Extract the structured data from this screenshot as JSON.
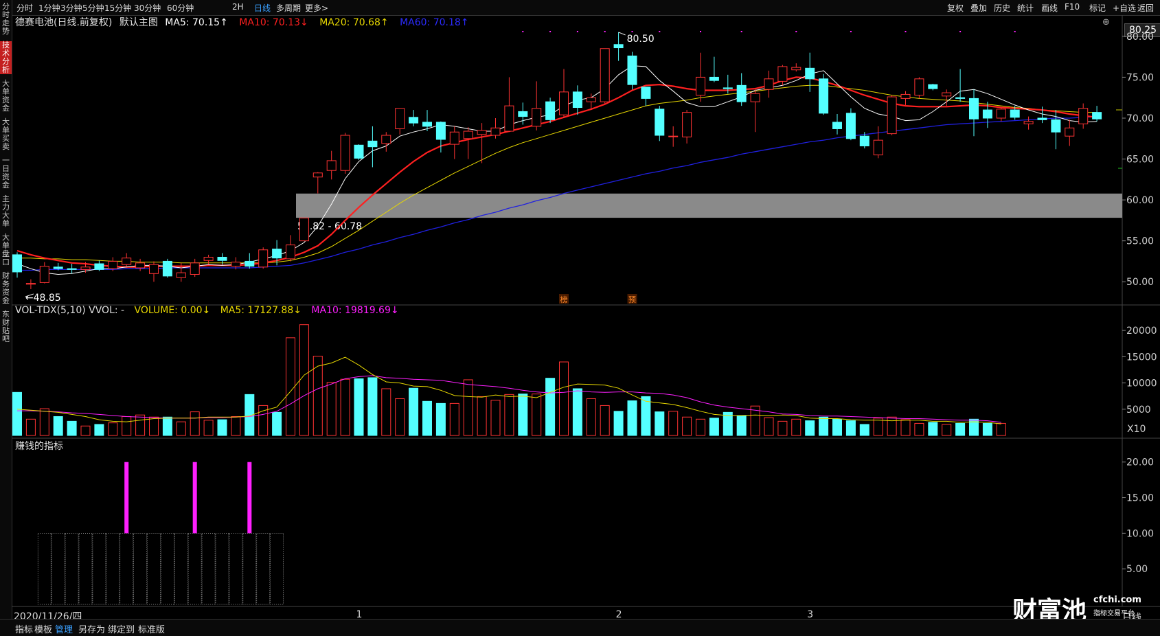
{
  "topbar": {
    "timeframes": [
      "分时",
      "1分钟",
      "3分钟",
      "5分钟",
      "15分钟",
      "30分钟",
      "60分钟",
      "2H",
      "日线",
      "多周期",
      "更多>"
    ],
    "active_timeframe": "日线",
    "tools": [
      "复权",
      "叠加",
      "历史",
      "统计",
      "画线",
      "F10",
      "标记",
      "+自选",
      "返回"
    ]
  },
  "sidebar": {
    "items": [
      "分时走势",
      "技术分析",
      "大单资金",
      "大单买卖",
      "一日资金",
      "主力大单",
      "大单盘口",
      "财务资金",
      "东财贴吧"
    ],
    "active": "技术分析"
  },
  "main_legend": {
    "stock": "德赛电池(日线.前复权)",
    "indicator": "默认主图",
    "ma5": "MA5: 70.15↑",
    "ma10": "MA10: 70.13↓",
    "ma20": "MA20: 70.68↑",
    "ma60": "MA60: 70.18↑"
  },
  "colors": {
    "up": "#ff3333",
    "down": "#54ffff",
    "ma5": "#ffffff",
    "ma10": "#ff2020",
    "ma20": "#e8d800",
    "ma60": "#2020e0",
    "magenta": "#ff20ff",
    "band": "#8a8a8a"
  },
  "annotations": {
    "high_label": "80.50",
    "low_label": "48.85",
    "band_label": "57.82 - 60.78",
    "marker1": "榜",
    "marker2": "预",
    "current_price": "80.25"
  },
  "vol_legend": {
    "name": "VOL-TDX(5,10) VVOL: -",
    "volume": "VOLUME: 0.00↓",
    "ma5": "MA5: 17127.88↓",
    "ma10": "MA10: 19819.69↓"
  },
  "vol_unit": "X10",
  "ind_legend": "赚钱的指标",
  "bottom": {
    "date": "2020/11/26/四",
    "tabs": [
      "指标",
      "模板",
      "管理",
      "另存为",
      "绑定到",
      "标准版"
    ],
    "active_tab": "管理",
    "period": "日线"
  },
  "logo": {
    "main": "财富池",
    "site": "cfchi.com",
    "tagline": "指标交易平台"
  },
  "chart_data": [
    {
      "type": "candlestick",
      "title": "德赛电池(日线.前复权)",
      "y_ticks": [
        "80.00",
        "75.00",
        "70.00",
        "65.00",
        "60.00",
        "55.00",
        "50.00"
      ],
      "ylim": [
        47.5,
        81.5
      ],
      "x_ticks": [
        "1",
        "2",
        "3"
      ],
      "candles": [
        {
          "o": 53.3,
          "h": 53.6,
          "l": 50.5,
          "c": 51.2
        },
        {
          "o": 49.7,
          "h": 50.3,
          "l": 49.1,
          "c": 49.8
        },
        {
          "o": 49.9,
          "h": 52.4,
          "l": 49.8,
          "c": 51.9
        },
        {
          "o": 51.8,
          "h": 52.3,
          "l": 51.4,
          "c": 51.6
        },
        {
          "o": 51.6,
          "h": 52.2,
          "l": 51.0,
          "c": 51.5
        },
        {
          "o": 51.5,
          "h": 52.4,
          "l": 51.1,
          "c": 51.8
        },
        {
          "o": 52.2,
          "h": 52.6,
          "l": 51.3,
          "c": 51.5
        },
        {
          "o": 51.6,
          "h": 53.0,
          "l": 51.3,
          "c": 52.5
        },
        {
          "o": 52.1,
          "h": 53.5,
          "l": 51.9,
          "c": 52.9
        },
        {
          "o": 51.7,
          "h": 52.8,
          "l": 51.3,
          "c": 52.3
        },
        {
          "o": 51.0,
          "h": 52.5,
          "l": 50.0,
          "c": 52.1
        },
        {
          "o": 52.5,
          "h": 52.8,
          "l": 50.5,
          "c": 50.7
        },
        {
          "o": 50.5,
          "h": 52.3,
          "l": 50.0,
          "c": 51.1
        },
        {
          "o": 50.9,
          "h": 52.8,
          "l": 50.6,
          "c": 52.3
        },
        {
          "o": 52.6,
          "h": 53.3,
          "l": 52.1,
          "c": 53.0
        },
        {
          "o": 53.0,
          "h": 53.5,
          "l": 52.1,
          "c": 52.6
        },
        {
          "o": 51.9,
          "h": 53.0,
          "l": 51.5,
          "c": 52.4
        },
        {
          "o": 52.5,
          "h": 53.5,
          "l": 51.6,
          "c": 51.9
        },
        {
          "o": 51.8,
          "h": 54.2,
          "l": 51.6,
          "c": 53.9
        },
        {
          "o": 54.0,
          "h": 55.1,
          "l": 52.0,
          "c": 52.9
        },
        {
          "o": 52.8,
          "h": 55.7,
          "l": 52.5,
          "c": 54.5
        },
        {
          "o": 55.0,
          "h": 57.8,
          "l": 55.0,
          "c": 57.8
        },
        {
          "o": 62.8,
          "h": 63.4,
          "l": 60.8,
          "c": 63.3
        },
        {
          "o": 63.6,
          "h": 66.0,
          "l": 62.5,
          "c": 64.8
        },
        {
          "o": 63.6,
          "h": 68.2,
          "l": 63.2,
          "c": 67.9
        },
        {
          "o": 66.7,
          "h": 66.8,
          "l": 64.9,
          "c": 65.1
        },
        {
          "o": 67.2,
          "h": 69.0,
          "l": 64.0,
          "c": 66.5
        },
        {
          "o": 66.9,
          "h": 68.3,
          "l": 65.9,
          "c": 67.9
        },
        {
          "o": 68.7,
          "h": 71.2,
          "l": 68.0,
          "c": 71.2
        },
        {
          "o": 70.1,
          "h": 71.0,
          "l": 69.0,
          "c": 69.4
        },
        {
          "o": 69.5,
          "h": 71.0,
          "l": 68.4,
          "c": 69.0
        },
        {
          "o": 69.5,
          "h": 69.6,
          "l": 65.8,
          "c": 67.4
        },
        {
          "o": 66.8,
          "h": 69.0,
          "l": 65.0,
          "c": 68.3
        },
        {
          "o": 67.5,
          "h": 68.9,
          "l": 65.0,
          "c": 68.4
        },
        {
          "o": 68.0,
          "h": 69.4,
          "l": 64.5,
          "c": 68.5
        },
        {
          "o": 67.9,
          "h": 70.0,
          "l": 67.5,
          "c": 68.8
        },
        {
          "o": 68.4,
          "h": 75.0,
          "l": 68.3,
          "c": 71.5
        },
        {
          "o": 70.8,
          "h": 71.9,
          "l": 69.2,
          "c": 70.2
        },
        {
          "o": 69.0,
          "h": 74.5,
          "l": 68.5,
          "c": 71.2
        },
        {
          "o": 72.0,
          "h": 72.5,
          "l": 69.4,
          "c": 69.8
        },
        {
          "o": 70.4,
          "h": 76.0,
          "l": 70.0,
          "c": 73.2
        },
        {
          "o": 73.2,
          "h": 74.0,
          "l": 70.4,
          "c": 71.3
        },
        {
          "o": 72.0,
          "h": 73.0,
          "l": 71.0,
          "c": 72.5
        },
        {
          "o": 72.0,
          "h": 78.5,
          "l": 71.8,
          "c": 78.5
        },
        {
          "o": 79.0,
          "h": 80.5,
          "l": 77.0,
          "c": 78.6
        },
        {
          "o": 77.6,
          "h": 78.1,
          "l": 73.5,
          "c": 74.1
        },
        {
          "o": 73.8,
          "h": 73.8,
          "l": 71.5,
          "c": 72.4
        },
        {
          "o": 71.1,
          "h": 71.5,
          "l": 67.2,
          "c": 67.9
        },
        {
          "o": 67.8,
          "h": 69.0,
          "l": 66.5,
          "c": 67.8
        },
        {
          "o": 67.7,
          "h": 71.0,
          "l": 66.9,
          "c": 70.7
        },
        {
          "o": 72.8,
          "h": 78.0,
          "l": 72.0,
          "c": 75.0
        },
        {
          "o": 75.0,
          "h": 77.5,
          "l": 74.4,
          "c": 74.6
        },
        {
          "o": 73.7,
          "h": 75.3,
          "l": 73.0,
          "c": 73.6
        },
        {
          "o": 74.0,
          "h": 75.5,
          "l": 71.5,
          "c": 72.0
        },
        {
          "o": 72.0,
          "h": 73.5,
          "l": 68.3,
          "c": 73.0
        },
        {
          "o": 73.5,
          "h": 75.8,
          "l": 72.5,
          "c": 74.8
        },
        {
          "o": 74.5,
          "h": 76.5,
          "l": 74.0,
          "c": 76.3
        },
        {
          "o": 75.9,
          "h": 76.7,
          "l": 75.7,
          "c": 76.2
        },
        {
          "o": 76.1,
          "h": 78.0,
          "l": 73.2,
          "c": 74.8
        },
        {
          "o": 74.8,
          "h": 75.4,
          "l": 70.4,
          "c": 70.6
        },
        {
          "o": 69.5,
          "h": 70.5,
          "l": 68.0,
          "c": 68.7
        },
        {
          "o": 70.6,
          "h": 71.2,
          "l": 67.3,
          "c": 67.5
        },
        {
          "o": 67.8,
          "h": 68.3,
          "l": 66.3,
          "c": 66.6
        },
        {
          "o": 65.5,
          "h": 69.0,
          "l": 65.1,
          "c": 67.3
        },
        {
          "o": 68.1,
          "h": 72.8,
          "l": 67.9,
          "c": 72.6
        },
        {
          "o": 72.4,
          "h": 73.3,
          "l": 71.6,
          "c": 72.9
        },
        {
          "o": 72.8,
          "h": 75.0,
          "l": 72.4,
          "c": 74.8
        },
        {
          "o": 74.1,
          "h": 74.2,
          "l": 73.4,
          "c": 73.6
        },
        {
          "o": 72.7,
          "h": 73.5,
          "l": 71.5,
          "c": 73.1
        },
        {
          "o": 72.5,
          "h": 76.0,
          "l": 72.0,
          "c": 72.4
        },
        {
          "o": 72.4,
          "h": 73.5,
          "l": 67.8,
          "c": 69.9
        },
        {
          "o": 71.0,
          "h": 72.0,
          "l": 68.8,
          "c": 70.0
        },
        {
          "o": 70.0,
          "h": 71.3,
          "l": 69.6,
          "c": 71.1
        },
        {
          "o": 71.0,
          "h": 71.5,
          "l": 69.8,
          "c": 70.1
        },
        {
          "o": 69.3,
          "h": 70.2,
          "l": 68.6,
          "c": 69.6
        },
        {
          "o": 70.0,
          "h": 71.4,
          "l": 69.4,
          "c": 69.8
        },
        {
          "o": 69.8,
          "h": 71.0,
          "l": 66.2,
          "c": 68.3
        },
        {
          "o": 67.8,
          "h": 69.8,
          "l": 66.6,
          "c": 68.8
        },
        {
          "o": 69.3,
          "h": 71.8,
          "l": 68.7,
          "c": 71.2
        },
        {
          "o": 70.7,
          "h": 71.5,
          "l": 69.6,
          "c": 69.9
        }
      ],
      "ma_lines": {
        "ma5": [
          52.2,
          51.6,
          51.1,
          50.9,
          51.0,
          51.3,
          51.6,
          51.6,
          51.8,
          52.0,
          52.0,
          51.9,
          51.7,
          51.9,
          52.1,
          52.0,
          52.1,
          52.4,
          52.8,
          53.2,
          53.8,
          54.8,
          56.8,
          59.5,
          62.6,
          64.7,
          66.0,
          66.6,
          67.8,
          68.3,
          68.7,
          69.2,
          69.0,
          68.7,
          68.4,
          68.4,
          69.2,
          69.7,
          70.1,
          70.4,
          71.5,
          72.2,
          72.5,
          73.6,
          75.3,
          76.4,
          76.3,
          74.6,
          73.3,
          71.9,
          71.4,
          71.4,
          72.0,
          72.6,
          73.4,
          73.7,
          74.0,
          74.6,
          75.4,
          75.8,
          74.2,
          72.6,
          71.2,
          70.5,
          70.2,
          69.7,
          69.8,
          70.8,
          72.0,
          73.3,
          73.5,
          73.0,
          72.3,
          71.6,
          71.0,
          70.5,
          70.2,
          69.7,
          69.5,
          69.6
        ],
        "ma10": [
          53.8,
          53.3,
          52.9,
          52.6,
          52.3,
          52.2,
          52.0,
          51.9,
          51.8,
          51.8,
          51.9,
          51.9,
          51.9,
          51.9,
          52.0,
          52.0,
          52.0,
          52.1,
          52.3,
          52.6,
          53.0,
          53.6,
          54.4,
          55.8,
          57.5,
          59.1,
          60.6,
          62.0,
          63.4,
          64.7,
          65.8,
          66.6,
          67.0,
          67.4,
          67.7,
          68.0,
          68.4,
          68.8,
          69.2,
          69.6,
          70.1,
          70.6,
          71.1,
          71.7,
          72.5,
          73.4,
          74.0,
          74.1,
          73.9,
          73.6,
          73.4,
          73.4,
          73.4,
          73.5,
          73.6,
          74.0,
          74.6,
          75.0,
          74.9,
          74.5,
          74.0,
          73.4,
          72.8,
          72.3,
          71.8,
          71.5,
          71.4,
          71.4,
          71.4,
          71.5,
          71.6,
          71.5,
          71.3,
          71.2,
          71.1,
          71.0,
          70.8,
          70.5,
          70.3,
          70.1
        ],
        "ma20": [
          52.9,
          52.9,
          52.8,
          52.8,
          52.7,
          52.7,
          52.6,
          52.5,
          52.5,
          52.4,
          52.4,
          52.4,
          52.3,
          52.3,
          52.3,
          52.3,
          52.3,
          52.3,
          52.3,
          52.4,
          52.6,
          53.0,
          53.5,
          54.3,
          55.3,
          56.3,
          57.4,
          58.5,
          59.6,
          60.6,
          61.5,
          62.4,
          63.3,
          64.1,
          64.9,
          65.7,
          66.4,
          67.0,
          67.5,
          68.0,
          68.5,
          69.0,
          69.5,
          70.0,
          70.5,
          71.0,
          71.5,
          71.8,
          72.0,
          72.2,
          72.5,
          72.7,
          72.9,
          73.1,
          73.3,
          73.5,
          73.7,
          73.9,
          74.0,
          74.0,
          73.8,
          73.6,
          73.4,
          73.1,
          72.8,
          72.6,
          72.4,
          72.3,
          72.2,
          72.1,
          71.9,
          71.7,
          71.5,
          71.3,
          71.2,
          71.0,
          70.9,
          70.8,
          70.7,
          70.7
        ],
        "ma60": [
          51.4,
          51.4,
          51.5,
          51.5,
          51.5,
          51.5,
          51.5,
          51.5,
          51.6,
          51.6,
          51.6,
          51.7,
          51.7,
          51.7,
          51.7,
          51.7,
          51.7,
          51.7,
          51.8,
          51.9,
          52.0,
          52.3,
          52.7,
          53.1,
          53.6,
          54.0,
          54.5,
          54.9,
          55.4,
          55.8,
          56.3,
          56.7,
          57.2,
          57.6,
          58.1,
          58.5,
          59.0,
          59.4,
          59.9,
          60.3,
          60.8,
          61.2,
          61.6,
          62.0,
          62.4,
          62.8,
          63.2,
          63.5,
          63.9,
          64.2,
          64.6,
          64.9,
          65.2,
          65.6,
          65.9,
          66.2,
          66.5,
          66.8,
          67.1,
          67.3,
          67.6,
          67.8,
          68.0,
          68.2,
          68.4,
          68.6,
          68.8,
          69.0,
          69.2,
          69.3,
          69.4,
          69.5,
          69.6,
          69.7,
          69.8,
          69.9,
          70.0,
          70.0,
          70.1,
          70.18
        ]
      },
      "band": {
        "low": 57.82,
        "high": 60.78
      },
      "high": 80.5,
      "low": 48.85
    },
    {
      "type": "bar",
      "title": "VOL-TDX(5,10)",
      "y_ticks": [
        "20000",
        "15000",
        "10000",
        "5000"
      ],
      "ylim": [
        0,
        22500
      ],
      "values": [
        8200,
        3100,
        5100,
        3600,
        2700,
        1800,
        2100,
        2400,
        3600,
        3900,
        3500,
        3500,
        2600,
        4500,
        2900,
        3000,
        3600,
        7800,
        5700,
        4400,
        18600,
        21100,
        15100,
        10100,
        10700,
        10800,
        11000,
        8900,
        7000,
        9000,
        6500,
        6100,
        6100,
        10600,
        7400,
        6700,
        7800,
        7900,
        7900,
        10900,
        14000,
        8900,
        7000,
        5700,
        4600,
        6600,
        7400,
        4500,
        4600,
        3500,
        3100,
        3300,
        4400,
        3800,
        5600,
        3400,
        2700,
        3100,
        2800,
        3500,
        3100,
        2800,
        2100,
        3300,
        3500,
        3000,
        2300,
        2500,
        2100,
        2300,
        3100,
        2300,
        2300
      ],
      "ma5": [
        5000,
        4800,
        4600,
        4400,
        4000,
        3600,
        3000,
        2700,
        2600,
        2900,
        3200,
        3300,
        3300,
        3300,
        3500,
        3500,
        3500,
        3700,
        4700,
        5400,
        8400,
        11500,
        13200,
        13800,
        14900,
        13400,
        11600,
        10200,
        10000,
        9400,
        9300,
        8600,
        7600,
        7400,
        7300,
        7700,
        7400,
        7500,
        7200,
        8200,
        9200,
        9800,
        9700,
        9600,
        9000,
        7700,
        6500,
        6200,
        5900,
        5300,
        4600,
        4000,
        3800,
        3800,
        3900,
        3800,
        3900,
        3800,
        3300,
        3200,
        3200,
        3000,
        2900,
        2900,
        2800,
        2900,
        2900,
        2700,
        2700,
        2500,
        2600,
        2500,
        2200
      ],
      "ma10": [
        4700,
        4700,
        4600,
        4500,
        4300,
        4200,
        4000,
        3800,
        3600,
        3500,
        3400,
        3300,
        3300,
        3300,
        3400,
        3400,
        3500,
        3600,
        4000,
        4600,
        6000,
        7600,
        8900,
        9800,
        10800,
        11200,
        11400,
        11000,
        10900,
        10700,
        10600,
        10500,
        10100,
        9700,
        9500,
        9300,
        9000,
        8600,
        8300,
        8100,
        8200,
        8500,
        8300,
        8200,
        8300,
        8300,
        8100,
        8000,
        7700,
        7200,
        6400,
        5800,
        5400,
        5100,
        4800,
        4500,
        4100,
        4000,
        3800,
        3700,
        3700,
        3600,
        3500,
        3400,
        3300,
        3200,
        3200,
        3100,
        3000,
        2900,
        2900,
        2800,
        2500
      ]
    },
    {
      "type": "bar",
      "title": "赚钱的指标",
      "y_ticks": [
        "20.00",
        "15.00",
        "10.00",
        "5.00"
      ],
      "ylim": [
        0,
        22
      ],
      "magenta_bars": [
        {
          "index": 8,
          "value": 20
        },
        {
          "index": 13,
          "value": 20
        },
        {
          "index": 17,
          "value": 20
        }
      ],
      "box_range": {
        "start": 2,
        "end": 19,
        "value": 10
      }
    }
  ]
}
